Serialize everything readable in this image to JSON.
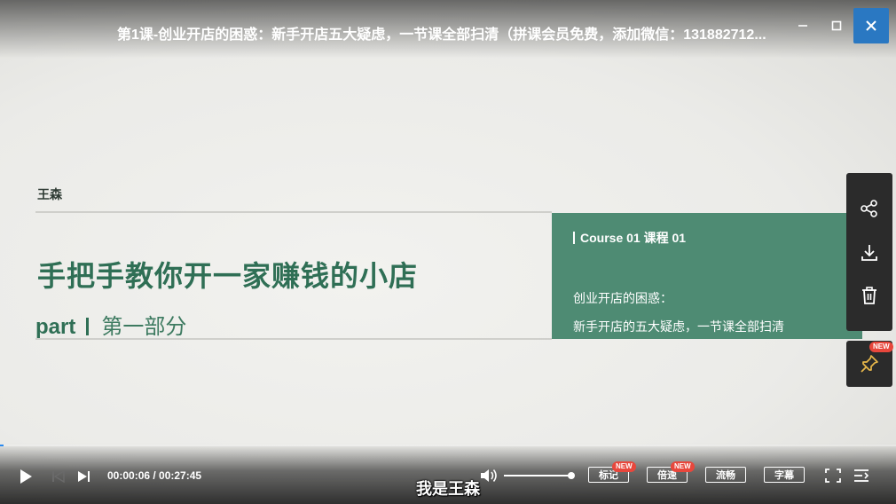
{
  "window": {
    "title": "第1课-创业开店的困惑：新手开店五大疑虑，一节课全部扫清（拼课会员免费，添加微信：131882712..."
  },
  "slide": {
    "author": "王森",
    "main_title": "手把手教你开一家赚钱的小店",
    "part_en": "part",
    "part_cn": "第一部分",
    "course_head": "Course 01  课程 01",
    "course_line1": "创业开店的困惑：",
    "course_line2": "新手开店的五大疑虑，一节课全部扫清"
  },
  "player": {
    "time_display": "00:00:06 / 00:27:45",
    "progress": 0.0036,
    "volume": 1.0,
    "subtitle": "我是王森",
    "buttons": {
      "mark": "标记",
      "speed": "倍速",
      "quality": "流畅",
      "captions": "字幕"
    },
    "badges": {
      "new": "NEW"
    }
  },
  "colors": {
    "accent_green": "#4e8b73",
    "title_green": "#2f6f55",
    "close_blue": "#2a78c2",
    "badge_red": "#e8473c",
    "progress_blue": "#2a8af0"
  },
  "icons": [
    "close-icon",
    "minimize-icon",
    "maximize-icon",
    "share-icon",
    "download-icon",
    "trash-icon",
    "pin-icon",
    "play-icon",
    "prev-icon",
    "next-icon",
    "volume-icon",
    "fullscreen-icon",
    "playlist-icon"
  ]
}
